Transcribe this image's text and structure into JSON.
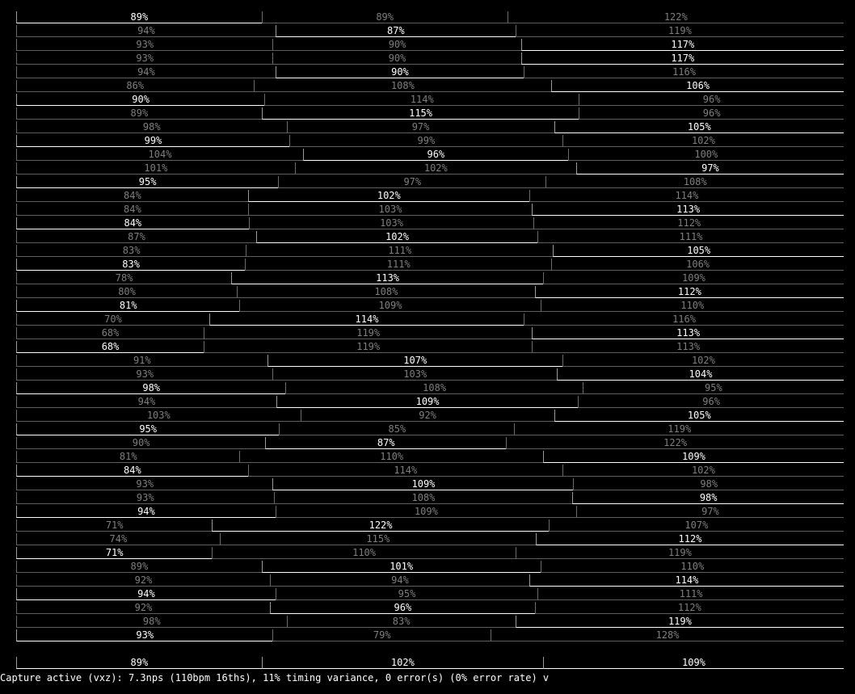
{
  "rows": [
    [
      "89%",
      "89%",
      "122%"
    ],
    [
      "94%",
      "87%",
      "119%"
    ],
    [
      "93%",
      "90%",
      "117%"
    ],
    [
      "93%",
      "90%",
      "117%"
    ],
    [
      "94%",
      "90%",
      "116%"
    ],
    [
      "86%",
      "108%",
      "106%"
    ],
    [
      "90%",
      "114%",
      "96%"
    ],
    [
      "89%",
      "115%",
      "96%"
    ],
    [
      "98%",
      "97%",
      "105%"
    ],
    [
      "99%",
      "99%",
      "102%"
    ],
    [
      "104%",
      "96%",
      "100%"
    ],
    [
      "101%",
      "102%",
      "97%"
    ],
    [
      "95%",
      "97%",
      "108%"
    ],
    [
      "84%",
      "102%",
      "114%"
    ],
    [
      "84%",
      "103%",
      "113%"
    ],
    [
      "84%",
      "103%",
      "112%"
    ],
    [
      "87%",
      "102%",
      "111%"
    ],
    [
      "83%",
      "111%",
      "105%"
    ],
    [
      "83%",
      "111%",
      "106%"
    ],
    [
      "78%",
      "113%",
      "109%"
    ],
    [
      "80%",
      "108%",
      "112%"
    ],
    [
      "81%",
      "109%",
      "110%"
    ],
    [
      "70%",
      "114%",
      "116%"
    ],
    [
      "68%",
      "119%",
      "113%"
    ],
    [
      "68%",
      "119%",
      "113%"
    ],
    [
      "91%",
      "107%",
      "102%"
    ],
    [
      "93%",
      "103%",
      "104%"
    ],
    [
      "98%",
      "108%",
      "95%"
    ],
    [
      "94%",
      "109%",
      "96%"
    ],
    [
      "103%",
      "92%",
      "105%"
    ],
    [
      "95%",
      "85%",
      "119%"
    ],
    [
      "90%",
      "87%",
      "122%"
    ],
    [
      "81%",
      "110%",
      "109%"
    ],
    [
      "84%",
      "114%",
      "102%"
    ],
    [
      "93%",
      "109%",
      "98%"
    ],
    [
      "93%",
      "108%",
      "98%"
    ],
    [
      "94%",
      "109%",
      "97%"
    ],
    [
      "71%",
      "122%",
      "107%"
    ],
    [
      "74%",
      "115%",
      "112%"
    ],
    [
      "71%",
      "110%",
      "119%"
    ],
    [
      "89%",
      "101%",
      "110%"
    ],
    [
      "92%",
      "94%",
      "114%"
    ],
    [
      "94%",
      "95%",
      "111%"
    ],
    [
      "92%",
      "96%",
      "112%"
    ],
    [
      "98%",
      "83%",
      "119%"
    ],
    [
      "93%",
      "79%",
      "128%"
    ]
  ],
  "highlighted": [
    0,
    1,
    2,
    2,
    1,
    2,
    0,
    1,
    2,
    0,
    1,
    2,
    0,
    1,
    2,
    0,
    1,
    2,
    0,
    1,
    2,
    0,
    1,
    2,
    0,
    1,
    2,
    0,
    1,
    2,
    0,
    1,
    2,
    0,
    1,
    2,
    0,
    1,
    2,
    0,
    1,
    2,
    0,
    1,
    2,
    0
  ],
  "summary": [
    "89%",
    "102%",
    "109%"
  ],
  "status_line": "Capture active (vxz): 7.3nps (110bpm 16ths), 11% timing variance, 0 error(s) (0% error rate) v"
}
